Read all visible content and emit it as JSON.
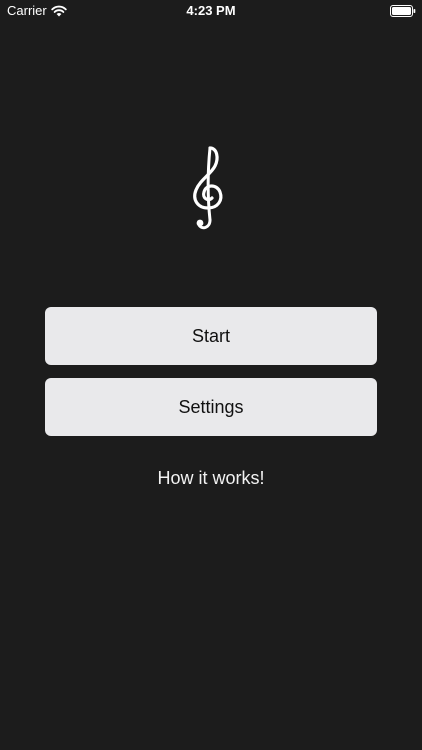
{
  "status_bar": {
    "carrier": "Carrier",
    "time": "4:23 PM",
    "wifi_icon": "wifi-icon",
    "battery_icon": "battery-icon"
  },
  "logo": {
    "icon": "treble-clef-icon"
  },
  "buttons": {
    "start_label": "Start",
    "settings_label": "Settings"
  },
  "links": {
    "how_it_works_label": "How it works!"
  },
  "colors": {
    "background": "#1c1c1c",
    "button_fill": "#e9e9eb",
    "button_text": "#111111",
    "text": "#ffffff"
  }
}
